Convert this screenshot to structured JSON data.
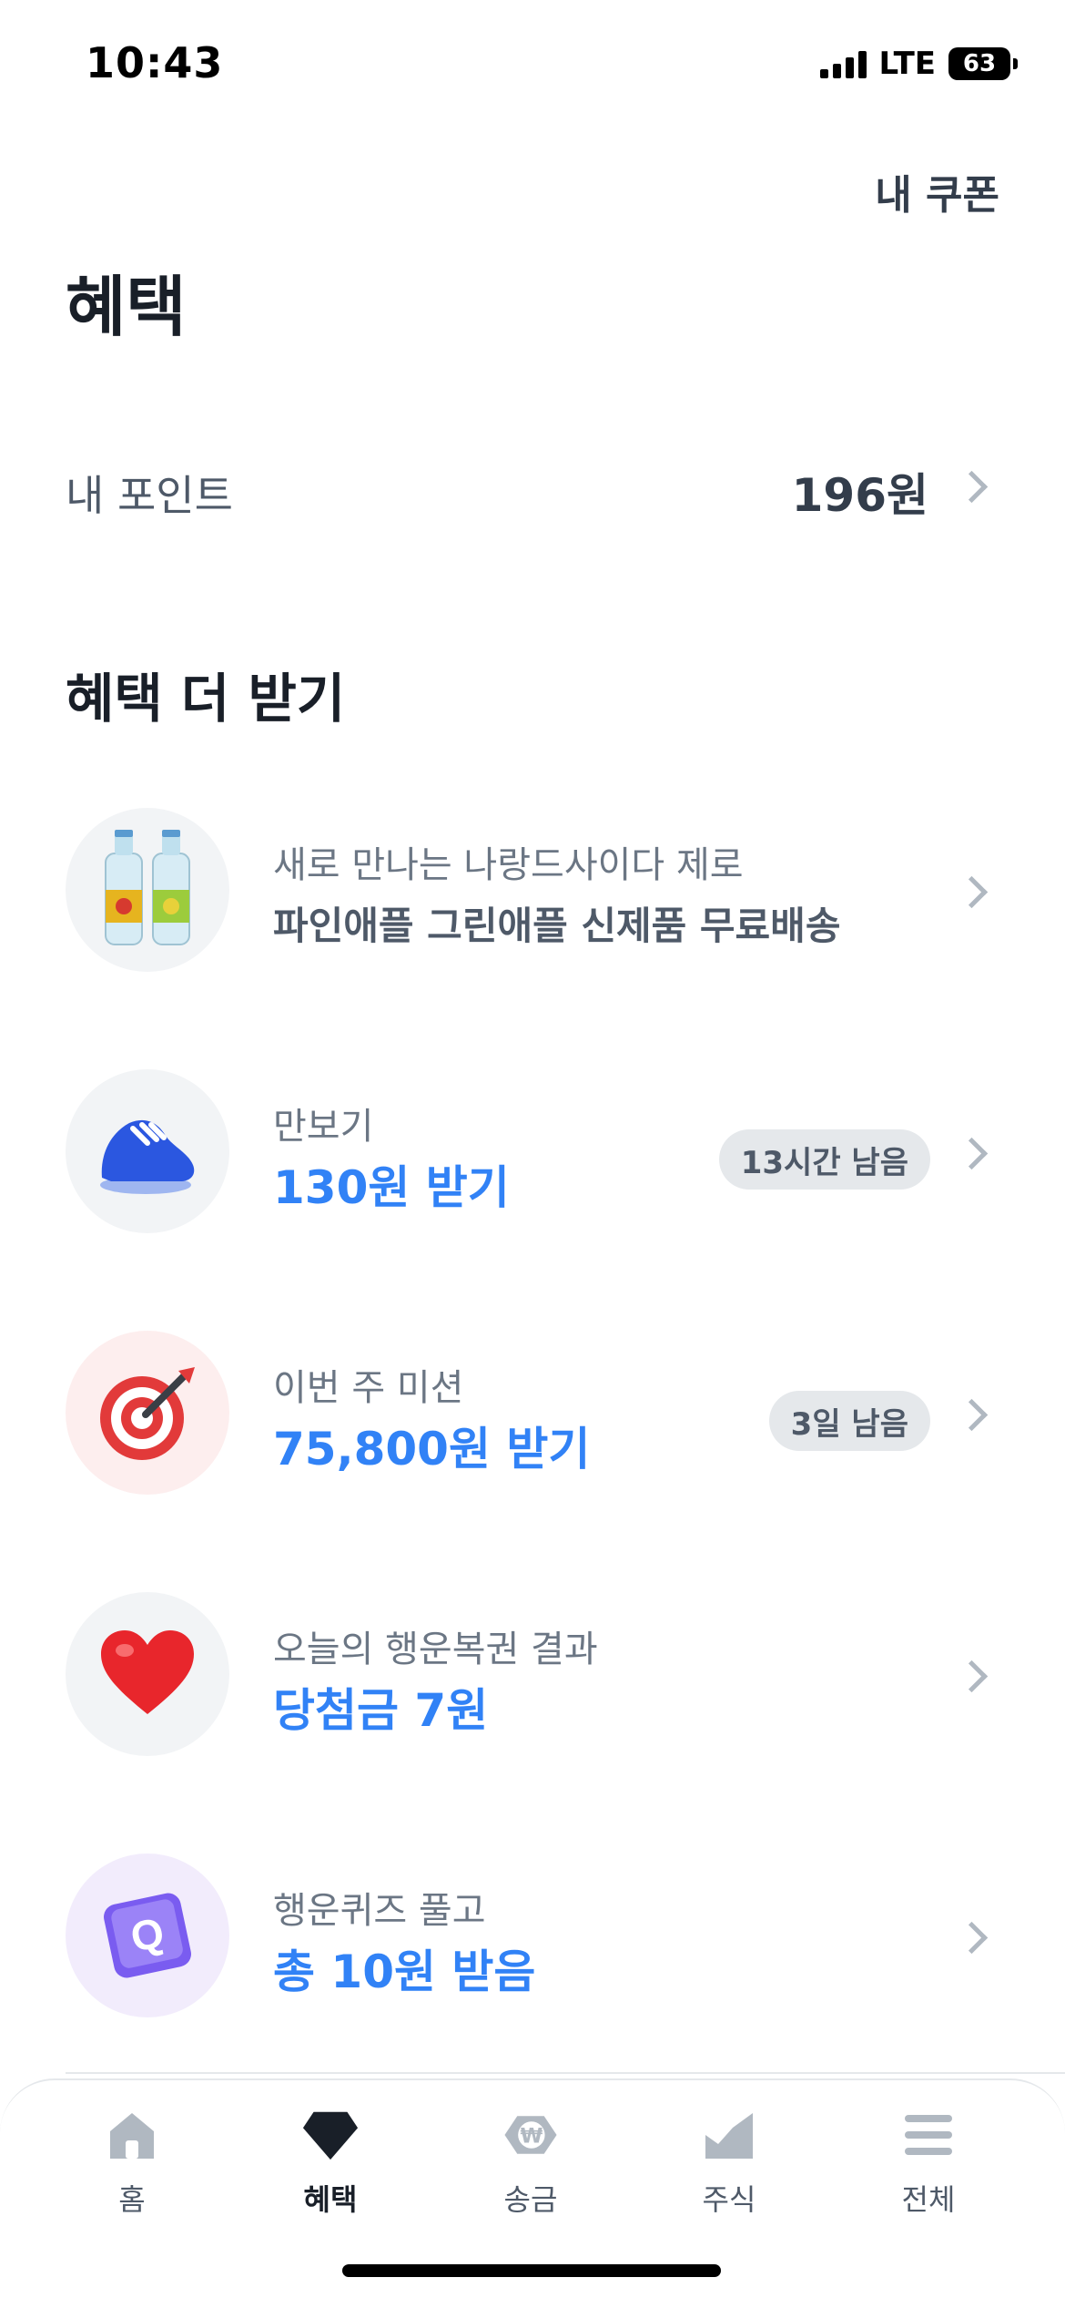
{
  "status_bar": {
    "time": "10:43",
    "network": "LTE",
    "battery": "63"
  },
  "header": {
    "coupon_link": "내 쿠폰",
    "title": "혜택"
  },
  "points": {
    "label": "내 포인트",
    "value": "196원"
  },
  "section": {
    "title": "혜택 더 받기"
  },
  "benefits": [
    {
      "icon": "soda-bottles-icon",
      "sub": "새로 만나는 나랑드사이다 제로",
      "main": "파인애플 그린애플 신제품 무료배송"
    },
    {
      "icon": "sneaker-icon",
      "sub": "만보기",
      "main": "130원 받기",
      "badge": "13시간 남음"
    },
    {
      "icon": "target-icon",
      "sub": "이번 주 미션",
      "main": "75,800원 받기",
      "badge": "3일 남음"
    },
    {
      "icon": "heart-icon",
      "sub": "오늘의 행운복권 결과",
      "main": "당첨금 7원"
    },
    {
      "icon": "quiz-q-icon",
      "sub": "행운퀴즈 풀고",
      "main": "총 10원 받음"
    }
  ],
  "tabs": [
    {
      "icon": "home-icon",
      "label": "홈"
    },
    {
      "icon": "benefit-gem-icon",
      "label": "혜택",
      "active": true
    },
    {
      "icon": "transfer-won-icon",
      "label": "송금"
    },
    {
      "icon": "stock-chart-icon",
      "label": "주식"
    },
    {
      "icon": "menu-icon",
      "label": "전체"
    }
  ],
  "colors": {
    "accent": "#3182f6",
    "text_primary": "#191f28",
    "text_secondary": "#6b7684",
    "icon_bg": "#f2f4f6",
    "badge_bg": "#e5e8eb",
    "tab_icon": "#b0b8c1"
  }
}
